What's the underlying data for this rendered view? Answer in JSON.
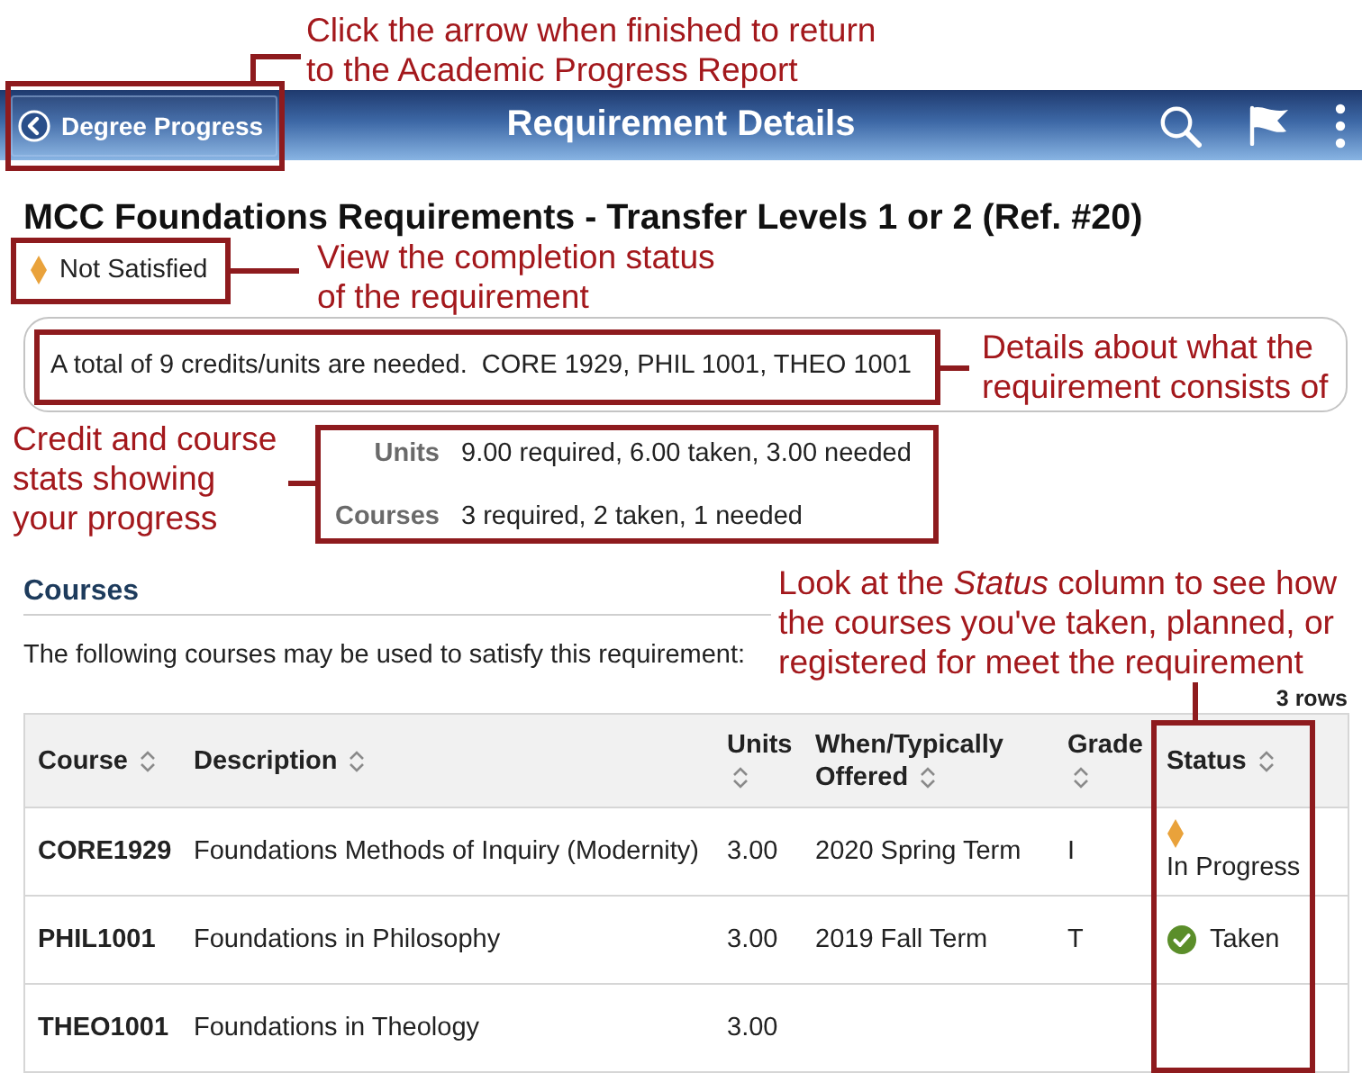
{
  "callouts": [
    {
      "text": "Click the arrow when finished to return to the Academic Progress Report"
    },
    {
      "text": "View the completion status of the requirement"
    },
    {
      "text": "Details about what the requirement consists of"
    },
    {
      "text": "Credit and course stats showing your progress"
    },
    {
      "text": "Look at the *Status* column to see how the courses you've taken, planned, or registered for meet the requirement"
    }
  ],
  "header": {
    "back_button": "Degree Progress",
    "title": "Requirement Details"
  },
  "requirement": {
    "title": "MCC Foundations Requirements - Transfer Levels 1 or 2 (Ref. #20)",
    "status": {
      "kind": "not_satisfied",
      "label": "Not Satisfied"
    },
    "details": "A total of 9 credits/units are needed.  CORE 1929, PHIL 1001, THEO 1001",
    "stats": [
      {
        "label": "Units",
        "value": "9.00 required, 6.00 taken, 3.00 needed"
      },
      {
        "label": "Courses",
        "value": "3 required, 2 taken, 1 needed"
      }
    ]
  },
  "courses": {
    "heading": "Courses",
    "intro": "The following courses may be used to satisfy this requirement:",
    "row_count": "3 rows",
    "columns": [
      "Course",
      "Description",
      "Units",
      "When/Typically Offered",
      "Grade",
      "Status"
    ],
    "rows": [
      {
        "course": "CORE1929",
        "description": "Foundations Methods of Inquiry (Modernity)",
        "units": "3.00",
        "offered": "2020 Spring Term",
        "grade": "I",
        "status": {
          "kind": "in_progress",
          "label": "In Progress"
        }
      },
      {
        "course": "PHIL1001",
        "description": "Foundations in Philosophy",
        "units": "3.00",
        "offered": "2019 Fall Term",
        "grade": "T",
        "status": {
          "kind": "taken",
          "label": "Taken"
        }
      },
      {
        "course": "THEO1001",
        "description": "Foundations in Theology",
        "units": "3.00"
      }
    ]
  }
}
